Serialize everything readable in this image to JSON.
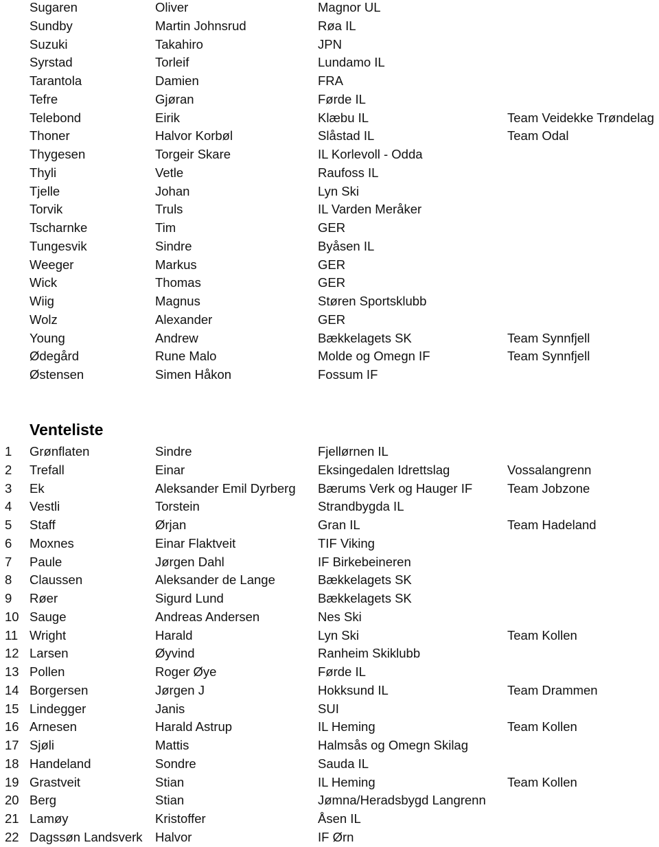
{
  "main_list": {
    "rows": [
      {
        "last": "Sugaren",
        "first": "Oliver",
        "club": "Magnor UL",
        "team": ""
      },
      {
        "last": "Sundby",
        "first": "Martin Johnsrud",
        "club": "Røa IL",
        "team": ""
      },
      {
        "last": "Suzuki",
        "first": "Takahiro",
        "club": "JPN",
        "team": ""
      },
      {
        "last": "Syrstad",
        "first": "Torleif",
        "club": "Lundamo IL",
        "team": ""
      },
      {
        "last": "Tarantola",
        "first": "Damien",
        "club": "FRA",
        "team": ""
      },
      {
        "last": "Tefre",
        "first": "Gjøran",
        "club": "Førde IL",
        "team": ""
      },
      {
        "last": "Telebond",
        "first": "Eirik",
        "club": "Klæbu IL",
        "team": "Team  Veidekke Trøndelag"
      },
      {
        "last": "Thoner",
        "first": "Halvor Korbøl",
        "club": "Slåstad IL",
        "team": "Team Odal"
      },
      {
        "last": "Thygesen",
        "first": "Torgeir Skare",
        "club": "IL Korlevoll - Odda",
        "team": ""
      },
      {
        "last": "Thyli",
        "first": "Vetle",
        "club": "Raufoss IL",
        "team": ""
      },
      {
        "last": "Tjelle",
        "first": "Johan",
        "club": "Lyn Ski",
        "team": ""
      },
      {
        "last": "Torvik",
        "first": "Truls",
        "club": "IL Varden Meråker",
        "team": ""
      },
      {
        "last": "Tscharnke",
        "first": "Tim",
        "club": "GER",
        "team": ""
      },
      {
        "last": "Tungesvik",
        "first": "Sindre",
        "club": "Byåsen IL",
        "team": ""
      },
      {
        "last": "Weeger",
        "first": "Markus",
        "club": "GER",
        "team": ""
      },
      {
        "last": "Wick",
        "first": "Thomas",
        "club": "GER",
        "team": ""
      },
      {
        "last": "Wiig",
        "first": "Magnus",
        "club": "Støren Sportsklubb",
        "team": ""
      },
      {
        "last": "Wolz",
        "first": "Alexander",
        "club": "GER",
        "team": ""
      },
      {
        "last": "Young",
        "first": "Andrew",
        "club": "Bækkelagets SK",
        "team": "Team Synnfjell"
      },
      {
        "last": "Ødegård",
        "first": "Rune Malo",
        "club": "Molde og Omegn IF",
        "team": "Team Synnfjell"
      },
      {
        "last": "Østensen",
        "first": "Simen Håkon",
        "club": "Fossum IF",
        "team": ""
      }
    ]
  },
  "waitlist": {
    "heading": "Venteliste",
    "rows": [
      {
        "num": "1",
        "last": "Grønflaten",
        "first": "Sindre",
        "club": "Fjellørnen IL",
        "team": ""
      },
      {
        "num": "2",
        "last": "Trefall",
        "first": "Einar",
        "club": "Eksingedalen Idrettslag",
        "team": "Vossalangrenn"
      },
      {
        "num": "3",
        "last": "Ek",
        "first": "Aleksander Emil Dyrberg",
        "club": "Bærums Verk og Hauger IF",
        "team": "Team Jobzone"
      },
      {
        "num": "4",
        "last": "Vestli",
        "first": "Torstein",
        "club": "Strandbygda IL",
        "team": ""
      },
      {
        "num": "5",
        "last": "Staff",
        "first": "Ørjan",
        "club": "Gran IL",
        "team": "Team Hadeland"
      },
      {
        "num": "6",
        "last": "Moxnes",
        "first": "Einar Flaktveit",
        "club": "TIF Viking",
        "team": ""
      },
      {
        "num": "7",
        "last": "Paule",
        "first": "Jørgen Dahl",
        "club": "IF Birkebeineren",
        "team": ""
      },
      {
        "num": "8",
        "last": "Claussen",
        "first": "Aleksander de Lange",
        "club": "Bækkelagets SK",
        "team": ""
      },
      {
        "num": "9",
        "last": "Røer",
        "first": "Sigurd Lund",
        "club": "Bækkelagets SK",
        "team": ""
      },
      {
        "num": "10",
        "last": "Sauge",
        "first": "Andreas Andersen",
        "club": "Nes Ski",
        "team": ""
      },
      {
        "num": "11",
        "last": "Wright",
        "first": "Harald",
        "club": "Lyn Ski",
        "team": "Team Kollen"
      },
      {
        "num": "12",
        "last": "Larsen",
        "first": "Øyvind",
        "club": "Ranheim Skiklubb",
        "team": ""
      },
      {
        "num": "13",
        "last": "Pollen",
        "first": "Roger Øye",
        "club": "Førde IL",
        "team": ""
      },
      {
        "num": "14",
        "last": "Borgersen",
        "first": "Jørgen J",
        "club": "Hokksund IL",
        "team": "Team Drammen"
      },
      {
        "num": "15",
        "last": "Lindegger",
        "first": "Janis",
        "club": "SUI",
        "team": ""
      },
      {
        "num": "16",
        "last": "Arnesen",
        "first": "Harald Astrup",
        "club": "IL Heming",
        "team": "Team Kollen"
      },
      {
        "num": "17",
        "last": "Sjøli",
        "first": "Mattis",
        "club": "Halmsås og Omegn Skilag",
        "team": ""
      },
      {
        "num": "18",
        "last": "Handeland",
        "first": "Sondre",
        "club": "Sauda IL",
        "team": ""
      },
      {
        "num": "19",
        "last": "Grastveit",
        "first": "Stian",
        "club": "IL Heming",
        "team": "Team Kollen"
      },
      {
        "num": "20",
        "last": "Berg",
        "first": "Stian",
        "club": "Jømna/Heradsbygd Langrenn",
        "team": ""
      },
      {
        "num": "21",
        "last": "Lamøy",
        "first": "Kristoffer",
        "club": "Åsen IL",
        "team": ""
      },
      {
        "num": "22",
        "last": "Dagssøn Landsverk",
        "first": "Halvor",
        "club": "IF Ørn",
        "team": ""
      }
    ]
  }
}
